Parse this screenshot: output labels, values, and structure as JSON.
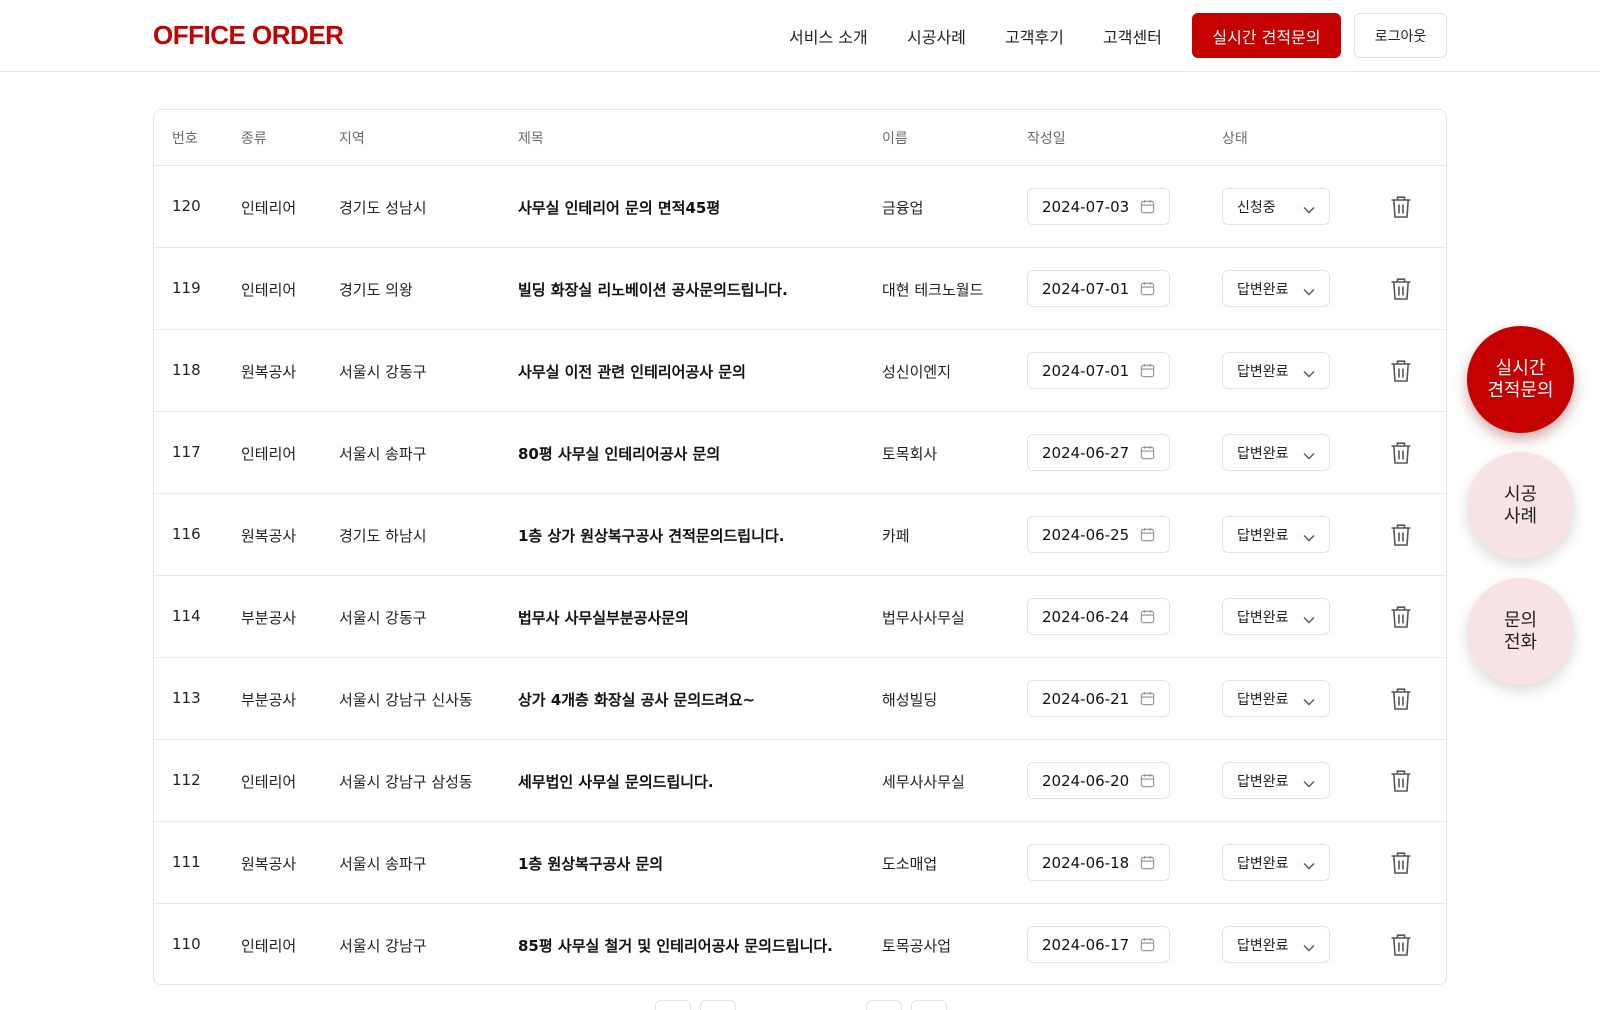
{
  "header": {
    "logo": "OFFICE ORDER",
    "nav": [
      "서비스 소개",
      "시공사례",
      "고객후기",
      "고객센터"
    ],
    "quote_button": "실시간 견적문의",
    "logout_button": "로그아웃"
  },
  "table": {
    "columns": [
      "번호",
      "종류",
      "지역",
      "제목",
      "이름",
      "작성일",
      "상태"
    ],
    "rows": [
      {
        "no": "120",
        "type": "인테리어",
        "region": "경기도 성남시",
        "title": "사무실 인테리어 문의 면적45평",
        "name": "금융업",
        "date": "2024-07-03",
        "status": "신청중"
      },
      {
        "no": "119",
        "type": "인테리어",
        "region": "경기도 의왕",
        "title": "빌딩 화장실 리노베이션 공사문의드립니다.",
        "name": "대현 테크노월드",
        "date": "2024-07-01",
        "status": "답변완료"
      },
      {
        "no": "118",
        "type": "원복공사",
        "region": "서울시 강동구",
        "title": "사무실 이전 관련 인테리어공사 문의",
        "name": "성신이엔지",
        "date": "2024-07-01",
        "status": "답변완료"
      },
      {
        "no": "117",
        "type": "인테리어",
        "region": "서울시 송파구",
        "title": "80평 사무실 인테리어공사 문의",
        "name": "토목회사",
        "date": "2024-06-27",
        "status": "답변완료"
      },
      {
        "no": "116",
        "type": "원복공사",
        "region": "경기도 하남시",
        "title": "1층 상가 원상복구공사 견적문의드립니다.",
        "name": "카페",
        "date": "2024-06-25",
        "status": "답변완료"
      },
      {
        "no": "114",
        "type": "부분공사",
        "region": "서울시 강동구",
        "title": "법무사 사무실부분공사문의",
        "name": "법무사사무실",
        "date": "2024-06-24",
        "status": "답변완료"
      },
      {
        "no": "113",
        "type": "부분공사",
        "region": "서울시 강남구 신사동",
        "title": "상가 4개층 화장실 공사 문의드려요~",
        "name": "해성빌딩",
        "date": "2024-06-21",
        "status": "답변완료"
      },
      {
        "no": "112",
        "type": "인테리어",
        "region": "서울시 강남구 삼성동",
        "title": "세무법인 사무실 문의드립니다.",
        "name": "세무사사무실",
        "date": "2024-06-20",
        "status": "답변완료"
      },
      {
        "no": "111",
        "type": "원복공사",
        "region": "서울시 송파구",
        "title": "1층 원상복구공사 문의",
        "name": "도소매업",
        "date": "2024-06-18",
        "status": "답변완료"
      },
      {
        "no": "110",
        "type": "인테리어",
        "region": "서울시 강남구",
        "title": "85평 사무실 철거 및 인테리어공사 문의드립니다.",
        "name": "토목공사업",
        "date": "2024-06-17",
        "status": "답변완료"
      }
    ]
  },
  "floating": {
    "quote": [
      "실시간",
      "견적문의"
    ],
    "cases": [
      "시공",
      "사례"
    ],
    "call": [
      "문의",
      "전화"
    ]
  },
  "colors": {
    "brand": "#c40000",
    "pink": "#f7e3e3"
  }
}
